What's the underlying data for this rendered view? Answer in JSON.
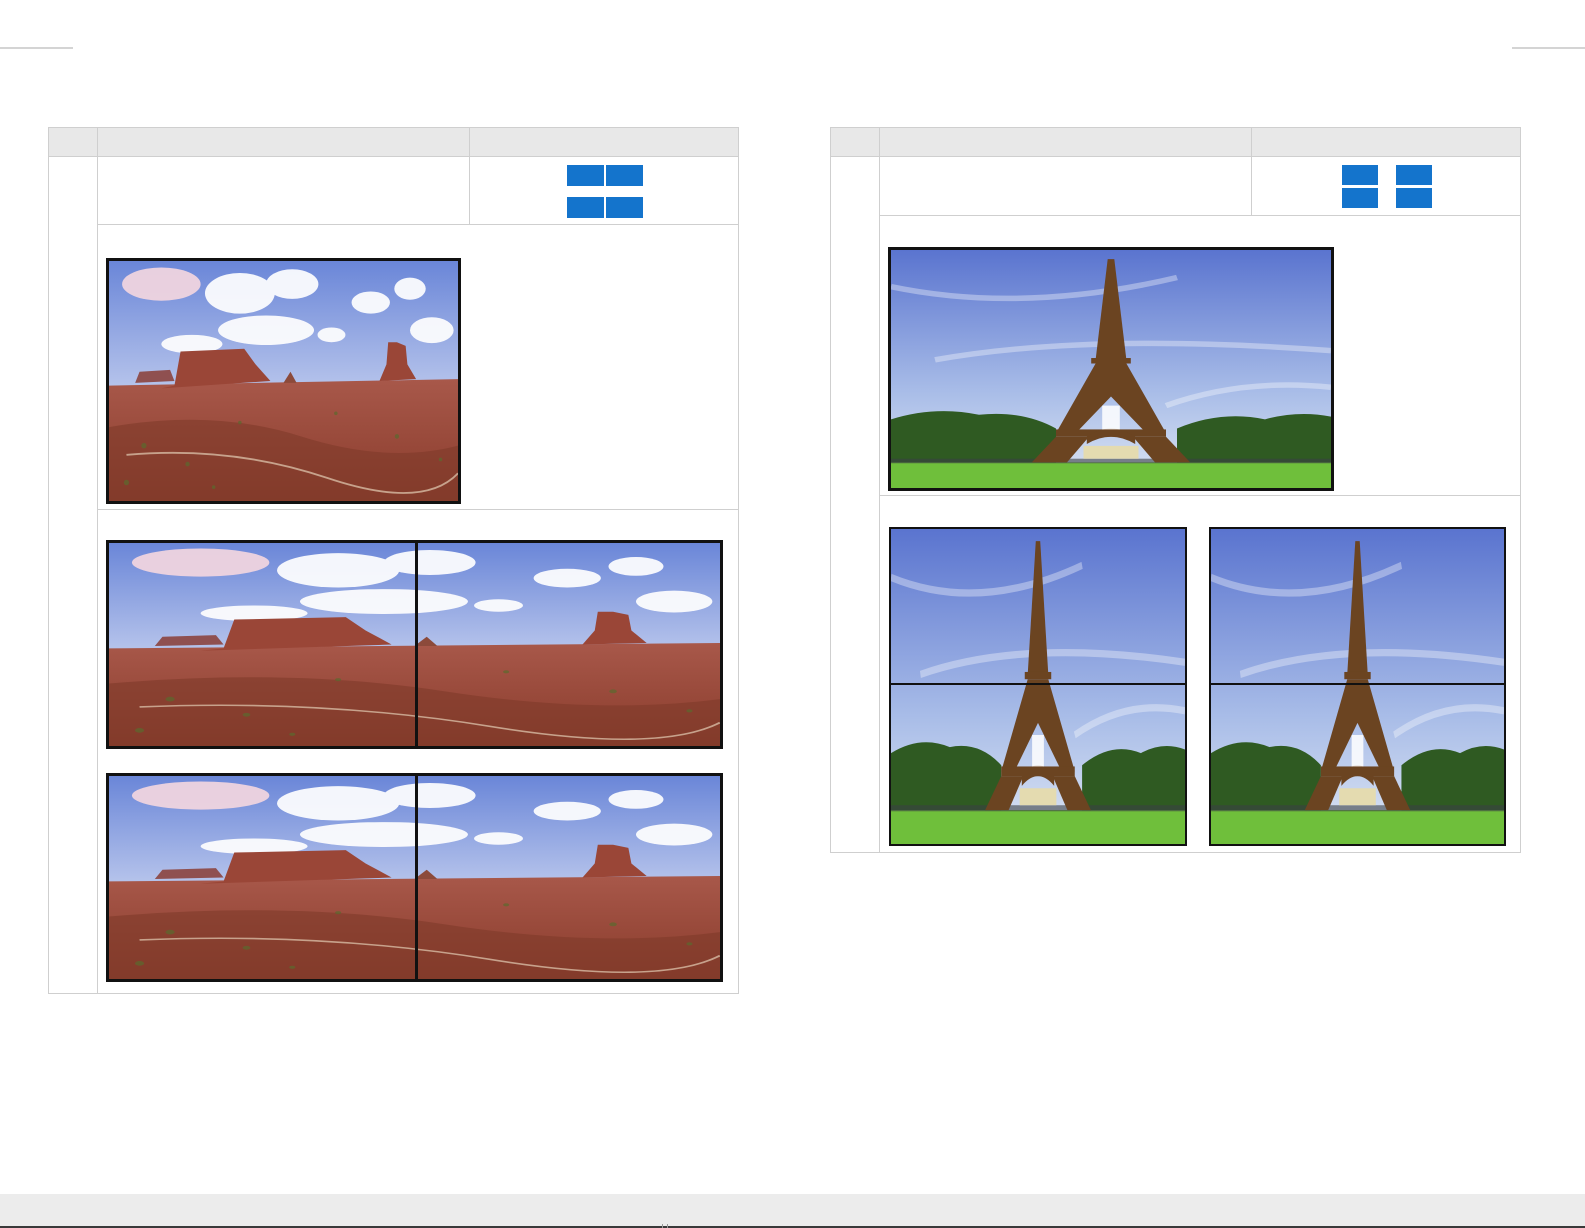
{
  "page": {
    "background": "#ffffff",
    "header_fill": "#e8e8e8",
    "border_color": "#cfcfcf",
    "accent_blue": "#1474cc",
    "footer_fill": "#ececec"
  },
  "left_panel": {
    "layout_icon": "2x2-grid-joined-icon",
    "source_image": "monument-valley-landscape",
    "wall_images": [
      "monument-valley-wall-top",
      "monument-valley-wall-bottom"
    ]
  },
  "right_panel": {
    "layout_icon": "2x2-grid-separated-icon",
    "source_image": "eiffel-tower-landscape",
    "wall_images": [
      "eiffel-tower-wall-left",
      "eiffel-tower-wall-right"
    ]
  }
}
